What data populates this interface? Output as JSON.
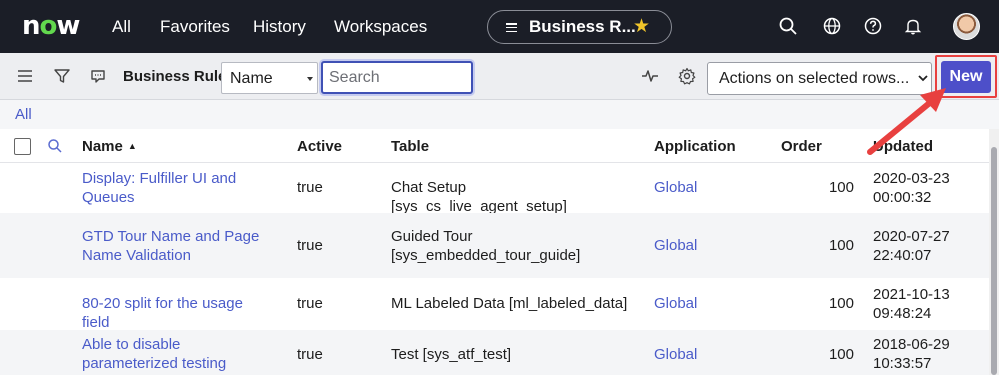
{
  "topnav": {
    "logo": "now",
    "links": [
      "All",
      "Favorites",
      "History",
      "Workspaces"
    ],
    "context_title": "Business R...",
    "icons": [
      "list-icon",
      "star-icon",
      "search-icon",
      "globe-icon",
      "help-icon",
      "bell-icon",
      "avatar"
    ]
  },
  "toolbar": {
    "title": "Business Rules",
    "field_select_value": "Name",
    "search_placeholder": "Search",
    "actions_select_value": "Actions on selected rows...",
    "new_label": "New",
    "icons": [
      "menu-icon",
      "filter-icon",
      "chat-icon",
      "pulse-icon",
      "gear-icon"
    ]
  },
  "filter": {
    "breadcrumb": "All"
  },
  "table": {
    "headers": {
      "name": "Name",
      "active": "Active",
      "table": "Table",
      "application": "Application",
      "order": "Order",
      "updated": "Updated"
    },
    "sort_indicator": "▲",
    "rows": [
      {
        "name": "Display: Fulfiller UI and Queues",
        "active": "true",
        "table": "Chat Setup [sys_cs_live_agent_setup]",
        "application": "Global",
        "order": "100",
        "updated": "2020-03-23 00:00:32"
      },
      {
        "name": "GTD Tour Name and Page Name Validation",
        "active": "true",
        "table": "Guided Tour [sys_embedded_tour_guide]",
        "application": "Global",
        "order": "100",
        "updated": "2020-07-27 22:40:07"
      },
      {
        "name": "80-20 split for the usage field",
        "active": "true",
        "table": "ML Labeled Data [ml_labeled_data]",
        "application": "Global",
        "order": "100",
        "updated": "2021-10-13 09:48:24"
      },
      {
        "name": "Able to disable parameterized testing",
        "active": "true",
        "table": "Test [sys_atf_test]",
        "application": "Global",
        "order": "100",
        "updated": "2018-06-29 10:33:57"
      }
    ]
  },
  "colors": {
    "nav_bg": "#1b1e27",
    "accent": "#4d4fc9",
    "link": "#4a5bc9",
    "highlight_red": "#e8403f",
    "logo_green": "#62d84e",
    "star": "#f0c52a"
  }
}
